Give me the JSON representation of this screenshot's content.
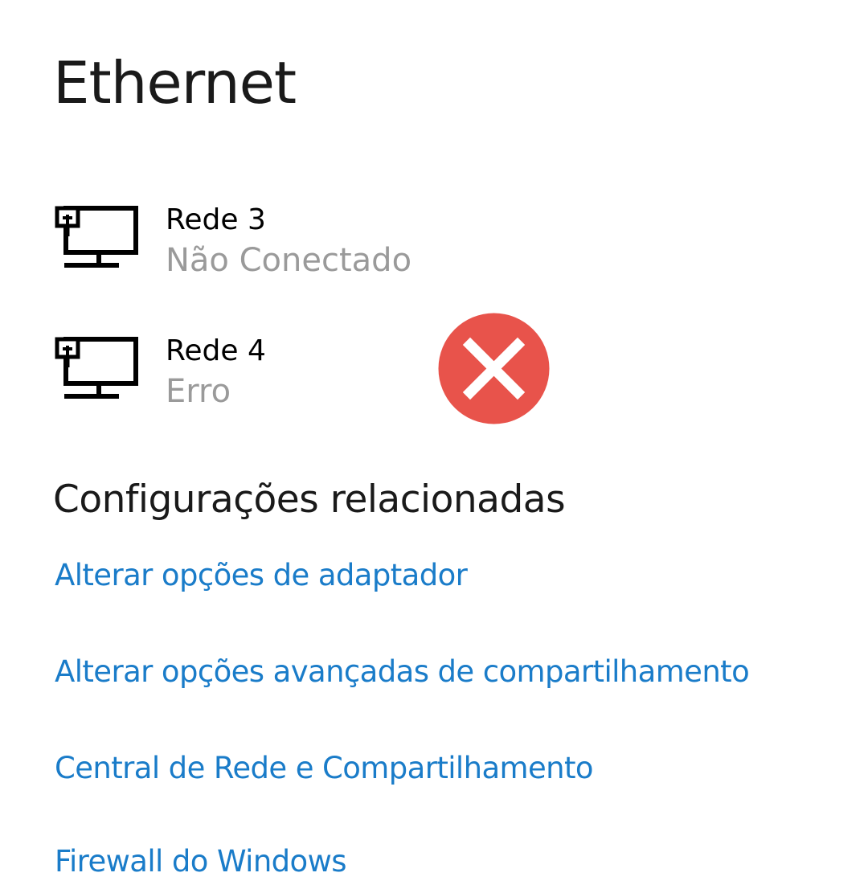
{
  "page": {
    "title": "Ethernet"
  },
  "networks": [
    {
      "name": "Rede 3",
      "status": "Não Conectado",
      "icon": "network-computer-icon"
    },
    {
      "name": "Rede 4",
      "status": "Erro",
      "icon": "network-computer-icon"
    }
  ],
  "error_badge": {
    "icon": "error-x-icon",
    "color": "#e8534b"
  },
  "related": {
    "title": "Configurações relacionadas",
    "links": [
      "Alterar opções de adaptador",
      "Alterar opções avançadas de compartilhamento",
      "Central de Rede e Compartilhamento",
      "Firewall do Windows"
    ]
  },
  "colors": {
    "link": "#1a7cc9",
    "secondary_text": "#9a9a9a",
    "primary_text": "#000000",
    "background": "#ffffff"
  }
}
